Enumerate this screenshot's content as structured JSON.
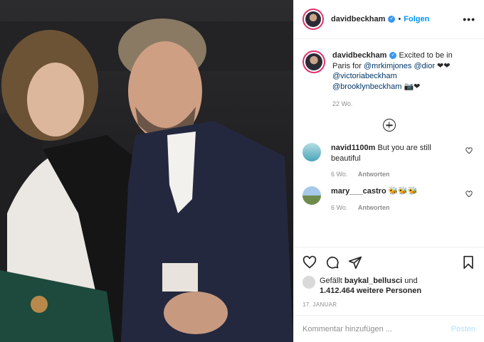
{
  "post": {
    "username": "davidbeckham",
    "follow_label": "Folgen",
    "more_label": "•••",
    "caption": {
      "username": "davidbeckham",
      "text_1": "Excited to be in Paris for ",
      "mention_1": "@mrkimjones",
      "text_2": " ",
      "mention_2": "@dior",
      "text_3": " ❤❤ ",
      "mention_3": "@victoriabeckham",
      "text_4": " ",
      "mention_4": "@brooklynbeckham",
      "text_5": " 📷❤",
      "age": "22 Wo."
    },
    "comments": [
      {
        "username": "navid1100m",
        "text": "But you are still beautiful",
        "age": "6 Wo.",
        "reply": "Antworten"
      },
      {
        "username": "mary___castro",
        "text": "🐝🐝🐝",
        "age": "6 Wo.",
        "reply": "Antworten"
      }
    ],
    "likes": {
      "prefix": "Gefällt ",
      "user": "baykal_bellusci",
      "middle": " und",
      "count": "1.412.464 weitere Personen"
    },
    "date": "17. JANUAR",
    "comment_placeholder": "Kommentar hinzufügen ...",
    "post_label": "Posten"
  }
}
